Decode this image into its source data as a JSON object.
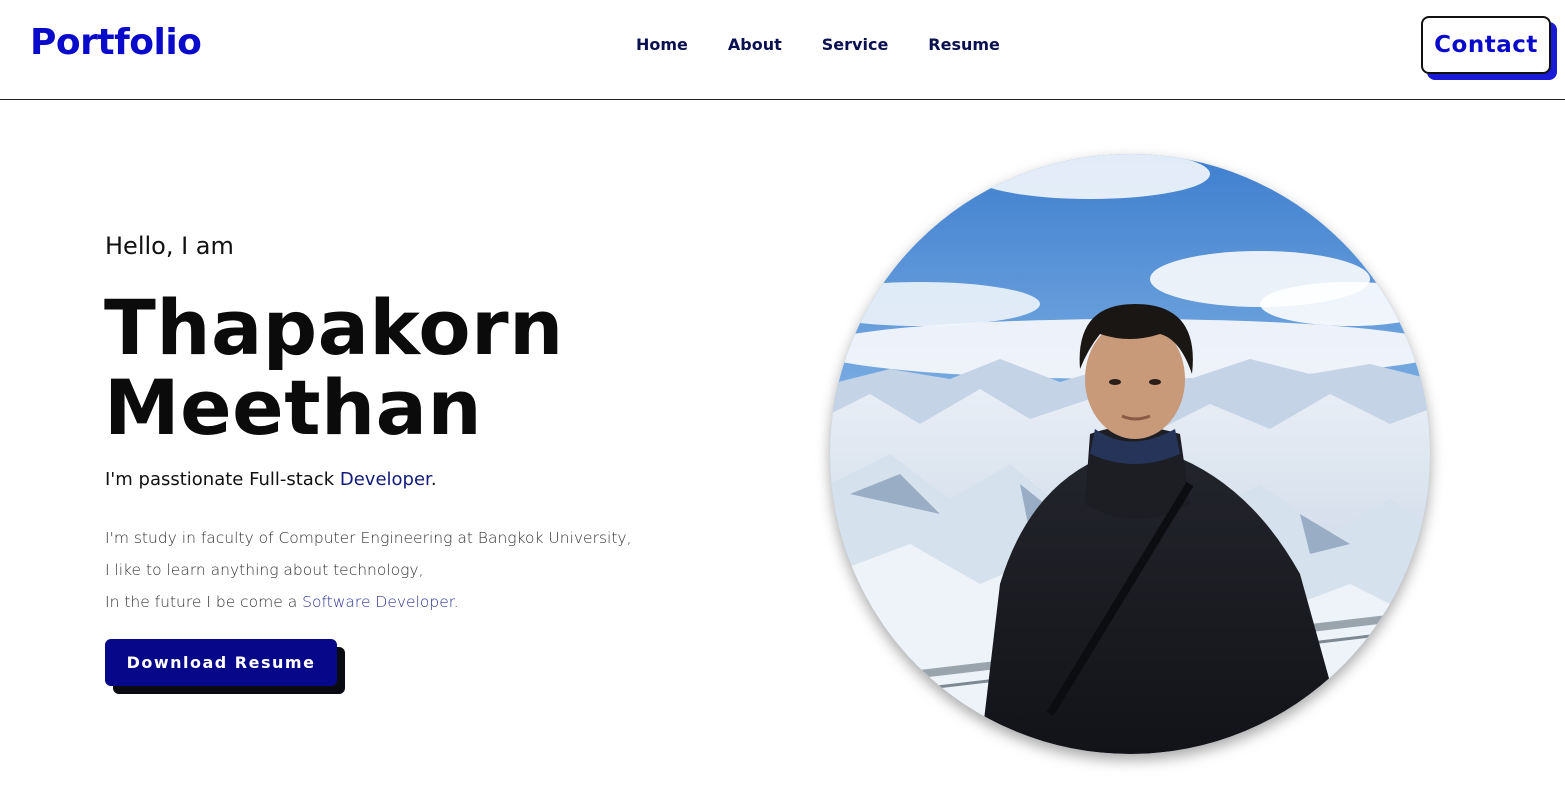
{
  "header": {
    "logo": "Portfolio",
    "nav": [
      "Home",
      "About",
      "Service",
      "Resume"
    ],
    "contact_label": "Contact"
  },
  "hero": {
    "greeting": "Hello, I am",
    "first_name": "Thapakorn",
    "last_name": "Meethan",
    "tagline_prefix": "I'm passtionate Full-stack ",
    "tagline_accent": "Developer",
    "tagline_suffix": ".",
    "bio_line1": "I'm study in faculty of Computer Engineering at Bangkok University,",
    "bio_line2": "I like to learn anything about technology,",
    "bio_line3_prefix": "In the future I be come a ",
    "bio_line3_accent": "Software Developer",
    "bio_line3_suffix": ".",
    "download_label": "Download Resume"
  },
  "colors": {
    "brand": "#0a0acb",
    "nav_text": "#0a1050",
    "button_bg": "#07078a",
    "contact_shadow": "#1a1ad6",
    "accent_text": "#101a7a"
  }
}
